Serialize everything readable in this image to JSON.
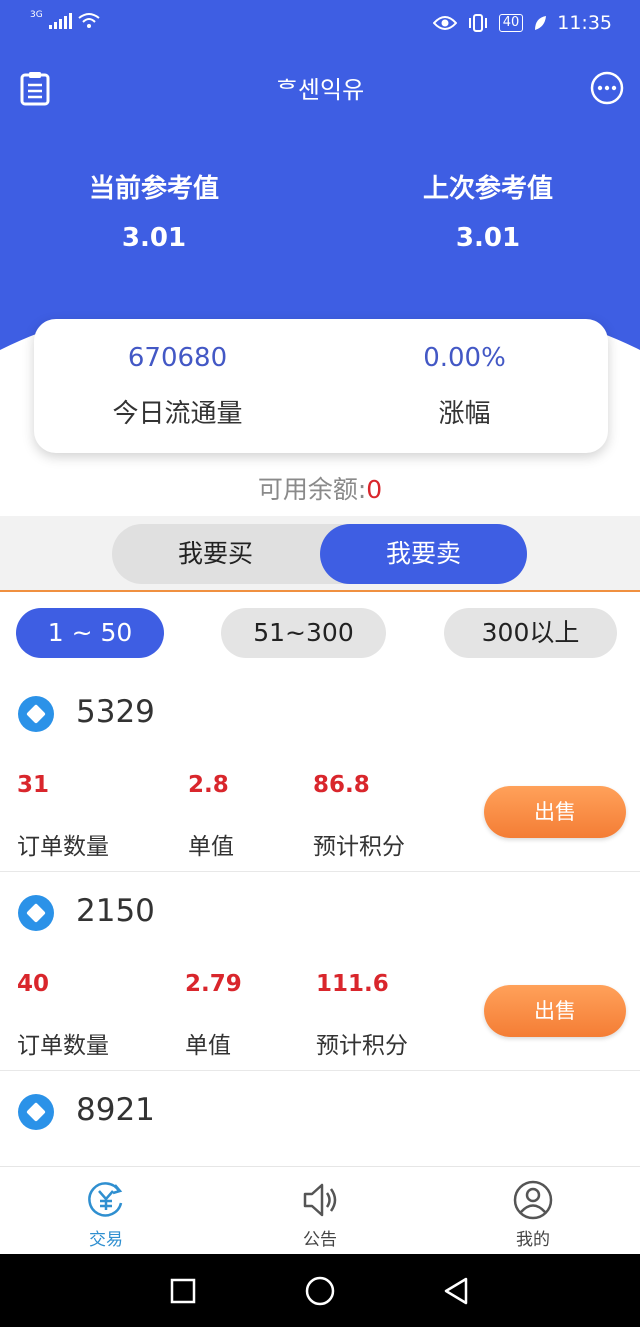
{
  "status_bar": {
    "network": "3G",
    "battery": "40",
    "time": "11:35"
  },
  "header": {
    "title": "ᄒ센익유"
  },
  "reference": {
    "current_label": "当前参考值",
    "current_value": "3.01",
    "previous_label": "上次参考值",
    "previous_value": "3.01"
  },
  "summary": {
    "volume_value": "670680",
    "volume_label": "今日流通量",
    "change_value": "0.00%",
    "change_label": "涨幅"
  },
  "balance": {
    "label": "可用余额:",
    "amount": "0"
  },
  "tabs": {
    "buy": "我要买",
    "sell": "我要卖"
  },
  "ranges": [
    "1 ~ 50",
    "51~300",
    "300以上"
  ],
  "labels": {
    "count": "订单数量",
    "unit": "单值",
    "points": "预计积分",
    "sell_button": "出售"
  },
  "items": [
    {
      "id": "5329",
      "count": "31",
      "unit": "2.8",
      "points": "86.8"
    },
    {
      "id": "2150",
      "count": "40",
      "unit": "2.79",
      "points": "111.6"
    },
    {
      "id": "8921"
    }
  ],
  "nav": [
    "交易",
    "公告",
    "我的"
  ],
  "colors": {
    "primary": "#3e5ee3",
    "accent": "#f47d35",
    "red": "#d9262c",
    "nav_active": "#2f8fd0"
  }
}
